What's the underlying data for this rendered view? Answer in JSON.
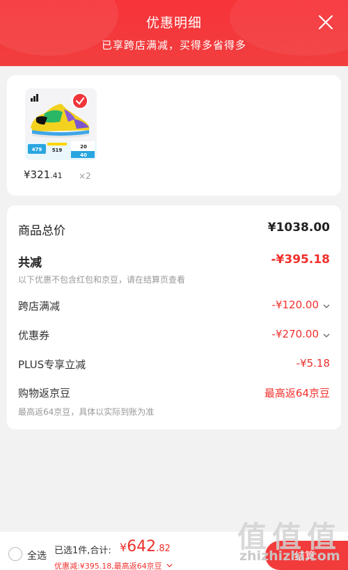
{
  "header": {
    "title": "优惠明细",
    "subtitle": "已享跨店满减，买得多省得多"
  },
  "product": {
    "badge_values": [
      "479",
      "519",
      "20",
      "40"
    ],
    "price_main": "¥321",
    "price_cents": ".41",
    "quantity": "×2"
  },
  "details": {
    "total_label": "商品总价",
    "total_value": "¥1038.00",
    "reduce_label": "共减",
    "reduce_value": "-¥395.18",
    "reduce_note": "以下优惠不包含红包和京豆，请在结算页查看",
    "cross_store_label": "跨店满减",
    "cross_store_value": "-¥120.00",
    "coupon_label": "优惠券",
    "coupon_value": "-¥270.00",
    "plus_label": "PLUS专享立减",
    "plus_value": "-¥5.18",
    "bean_label": "购物返京豆",
    "bean_value": "最高返64京豆",
    "bean_note": "最高返64京豆，具体以实际到账为准"
  },
  "footer": {
    "select_all": "全选",
    "summary": "已选1件,合计:",
    "total_symbol": "¥",
    "total_main": "642",
    "total_cents": ".82",
    "sub": "优惠减:¥395.18,最高返64京豆",
    "checkout": "结算"
  },
  "watermark": {
    "glyphs": [
      "值",
      "值",
      "值"
    ],
    "text": "zhizhizhi.com"
  },
  "colors": {
    "accent": "#f23b3b",
    "discount": "#f0302c",
    "plus": "#e8312d"
  }
}
